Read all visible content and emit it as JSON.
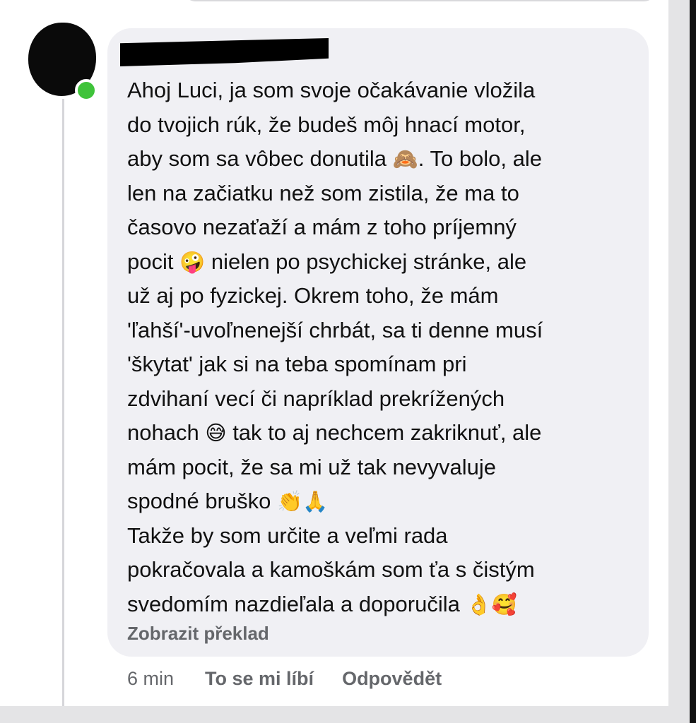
{
  "comment": {
    "author": "",
    "lines": [
      {
        "text": "Ahoj Luci, ja som svoje očakávanie vložila"
      },
      {
        "text": "do tvojich rúk, že budeš môj hnací motor,"
      },
      {
        "text": "aby som sa vôbec donutila",
        "emoji": "🙈",
        "after": ". To bolo, ale"
      },
      {
        "text": "len na začiatku než som zistila, že ma to"
      },
      {
        "text": "časovo nezaťaží a mám z toho príjemný"
      },
      {
        "text": "pocit",
        "emoji": "🤪",
        "after": " nielen po psychickej stránke, ale"
      },
      {
        "text": "už aj po fyzickej. Okrem toho, že mám"
      },
      {
        "text": "'ľahší'-uvoľnenejší chrbát, sa ti denne musí"
      },
      {
        "text": "'škytat' jak si na teba spomínam pri"
      },
      {
        "text": "zdvihaní vecí či napríklad prekrížených"
      },
      {
        "text": "nohach",
        "emoji": "😅",
        "after": " tak to aj nechcem zakriknuť, ale"
      },
      {
        "text": "mám pocit, že sa mi už tak nevyvaluje"
      },
      {
        "text": "spodné bruško",
        "emoji": "👏🙏",
        "after": ""
      },
      {
        "text": "Takže by som určite a veľmi rada"
      },
      {
        "text": "pokračovala a kamoškám som ťa s čistým"
      },
      {
        "text": "svedomím nazdieľala a doporučila",
        "emoji": "👌🥰",
        "after": ""
      }
    ],
    "translate_label": "Zobrazit překlad"
  },
  "actions": {
    "time": "6 min",
    "like_label": "To se mi líbí",
    "reply_label": "Odpovědět"
  },
  "colors": {
    "bubble": "#f0f0f4",
    "online": "#3fc33a",
    "meta_text": "#65676b"
  }
}
